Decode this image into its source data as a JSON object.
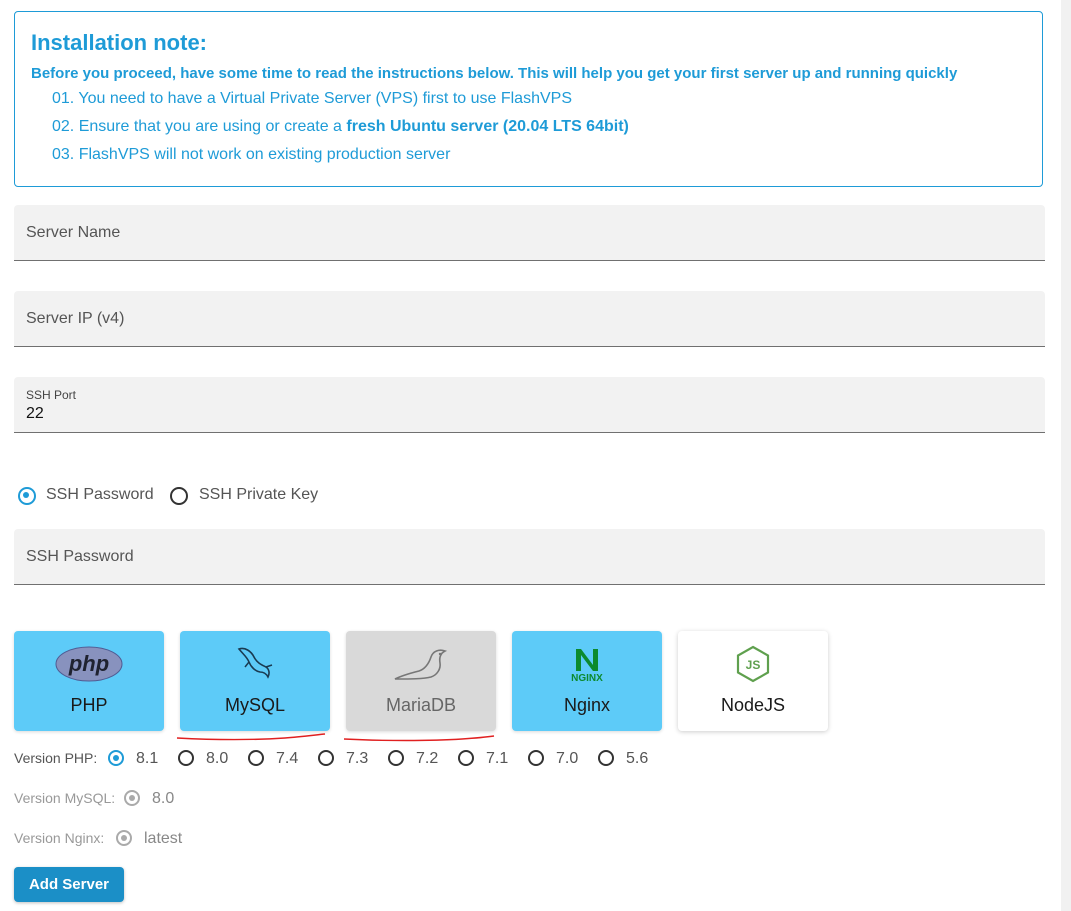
{
  "note": {
    "title": "Installation note:",
    "intro": "Before you proceed, have some time to read the instructions below. This will help you get your first server up and running quickly",
    "step1": "01. You need to have a Virtual Private Server (VPS) first to use FlashVPS",
    "step2_prefix": "02. Ensure that you are using or create a ",
    "step2_bold": "fresh Ubuntu server (20.04 LTS 64bit)",
    "step3": "03. FlashVPS will not work on existing production server",
    "accent_color": "#1e9bd7"
  },
  "form": {
    "server_name_label": "Server Name",
    "server_ip_label": "Server IP (v4)",
    "ssh_port_label": "SSH Port",
    "ssh_port_value": "22",
    "auth_options": [
      "SSH Password",
      "SSH Private Key"
    ],
    "auth_selected": "SSH Password",
    "ssh_password_label": "SSH Password"
  },
  "stack_cards": [
    {
      "label": "PHP",
      "icon": "php-logo-icon",
      "state": "active"
    },
    {
      "label": "MySQL",
      "icon": "mysql-dolphin-icon",
      "state": "active"
    },
    {
      "label": "MariaDB",
      "icon": "mariadb-seal-icon",
      "state": "disabled"
    },
    {
      "label": "Nginx",
      "icon": "nginx-logo-icon",
      "state": "active"
    },
    {
      "label": "NodeJS",
      "icon": "nodejs-logo-icon",
      "state": "inactive"
    }
  ],
  "versions": {
    "php_label": "Version PHP:",
    "php_options": [
      "8.1",
      "8.0",
      "7.4",
      "7.3",
      "7.2",
      "7.1",
      "7.0",
      "5.6"
    ],
    "php_selected": "8.1",
    "mysql_label": "Version MySQL:",
    "mysql_value": "8.0",
    "nginx_label": "Version Nginx:",
    "nginx_value": "latest"
  },
  "add_button": "Add Server"
}
